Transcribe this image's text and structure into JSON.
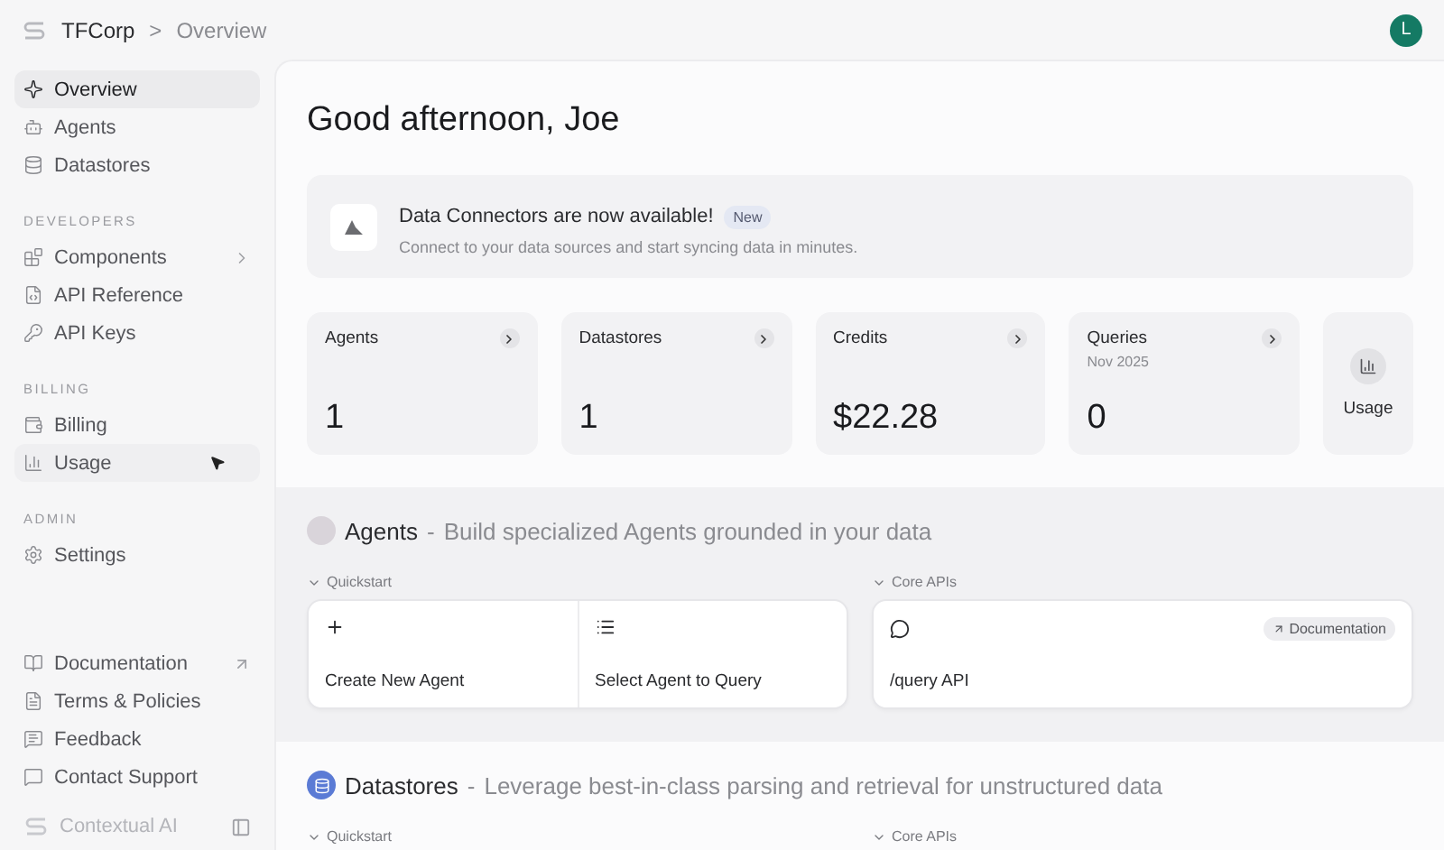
{
  "topbar": {
    "org": "TFCorp",
    "separator": ">",
    "page": "Overview",
    "avatar": "L"
  },
  "sidebar": {
    "groups": [
      {
        "items": [
          {
            "label": "Overview",
            "selected": true,
            "hovered": false
          },
          {
            "label": "Agents",
            "selected": false,
            "hovered": false
          },
          {
            "label": "Datastores",
            "selected": false,
            "hovered": false
          }
        ]
      },
      {
        "heading": "DEVELOPERS",
        "items": [
          {
            "label": "Components",
            "selected": false,
            "hovered": false,
            "expandable": true
          },
          {
            "label": "API Reference",
            "selected": false,
            "hovered": false
          },
          {
            "label": "API Keys",
            "selected": false,
            "hovered": false
          }
        ]
      },
      {
        "heading": "BILLING",
        "items": [
          {
            "label": "Billing",
            "selected": false,
            "hovered": false
          },
          {
            "label": "Usage",
            "selected": false,
            "hovered": true
          }
        ]
      },
      {
        "heading": "ADMIN",
        "items": [
          {
            "label": "Settings",
            "selected": false,
            "hovered": false
          }
        ]
      }
    ],
    "footer_items": [
      {
        "label": "Documentation",
        "external": true
      },
      {
        "label": "Terms & Policies",
        "external": false
      },
      {
        "label": "Feedback",
        "external": false
      },
      {
        "label": "Contact Support",
        "external": false
      }
    ],
    "brand": "Contextual AI"
  },
  "greeting": "Good afternoon, Joe",
  "banner": {
    "title": "Data Connectors are now available!",
    "badge": "New",
    "subtitle": "Connect to your data sources and start syncing data in minutes."
  },
  "stats": [
    {
      "kind": "stat",
      "label": "Agents",
      "value": "1"
    },
    {
      "kind": "stat",
      "label": "Datastores",
      "value": "1"
    },
    {
      "kind": "stat",
      "label": "Credits",
      "value": "$22.28"
    },
    {
      "kind": "stat",
      "label": "Queries",
      "sublabel": "Nov 2025",
      "value": "0"
    },
    {
      "kind": "link",
      "label": "Usage"
    }
  ],
  "sections": [
    {
      "title": "Agents",
      "separator": "-",
      "description": "Build specialized Agents grounded in your data",
      "highlighted": true,
      "quickstart": {
        "label": "Quickstart",
        "actions": [
          {
            "label": "Create New Agent"
          },
          {
            "label": "Select Agent to Query"
          }
        ]
      },
      "core_apis": {
        "label": "Core APIs",
        "api": "/query API",
        "badge": "Documentation"
      }
    },
    {
      "title": "Datastores",
      "separator": "-",
      "description": "Leverage best-in-class parsing and retrieval for unstructured data",
      "highlighted": false,
      "quickstart": {
        "label": "Quickstart"
      },
      "core_apis": {
        "label": "Core APIs"
      }
    }
  ]
}
